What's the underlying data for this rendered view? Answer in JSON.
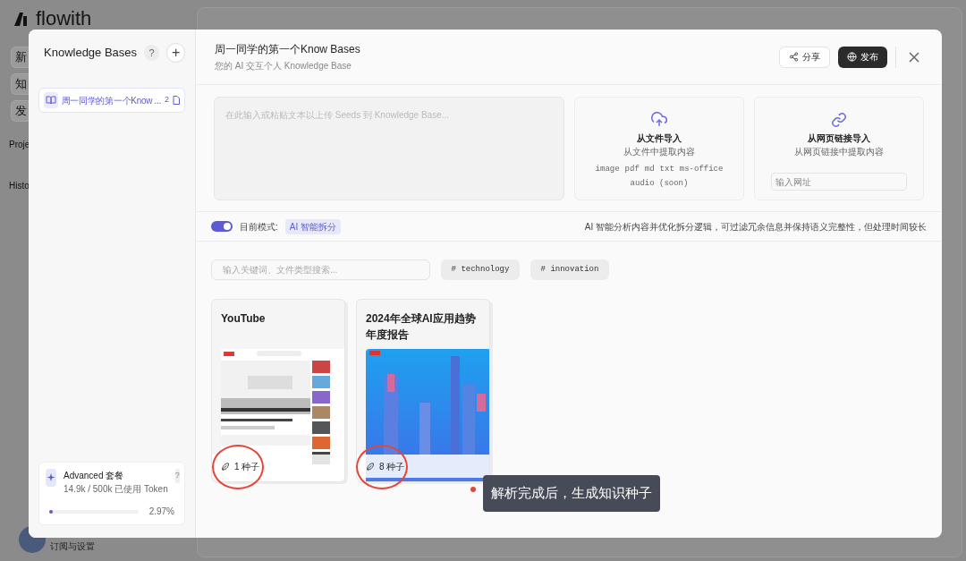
{
  "background_app": {
    "logo": "flowith",
    "nav_buttons": [
      "新",
      "知",
      "发"
    ],
    "section_labels": [
      "Proje",
      "Histo"
    ],
    "footer_link": "订阅与设置"
  },
  "sidebar": {
    "title": "Knowledge Bases",
    "help": "?",
    "add": "+",
    "items": [
      {
        "name": "周一同学的第一个Know ...",
        "count": "2",
        "selected": true
      }
    ],
    "plan": {
      "name": "Advanced 套餐",
      "usage": "14.9k / 500k 已使用 Token",
      "help": "?",
      "level": 0.0297,
      "percent": "2.97%"
    }
  },
  "header": {
    "title": "周一同学的第一个Know Bases",
    "subtitle": "您的 AI 交互个人 Knowledge Base",
    "share": "分享",
    "publish": "发布"
  },
  "upload": {
    "placeholder": "在此输入或粘贴文本以上传 Seeds 到 Knowledge Base...",
    "file_import": {
      "title": "从文件导入",
      "subtitle": "从文件中提取内容",
      "types": [
        "image",
        "pdf",
        "md",
        "txt",
        "ms-office",
        "audio (soon)"
      ]
    },
    "link_import": {
      "title": "从网页链接导入",
      "subtitle": "从网页链接中提取内容",
      "placeholder": "输入网址"
    }
  },
  "mode": {
    "on": true,
    "label": "目前模式:",
    "value": "AI 智能拆分",
    "description": "AI 智能分析内容并优化拆分逻辑，可过滤冗余信息并保持语义完整性，但处理时间较长"
  },
  "search": {
    "placeholder": "输入关键词、文件类型搜索..."
  },
  "tags": [
    "# technology",
    "# innovation"
  ],
  "seeds": [
    {
      "title": "YouTube",
      "kind": "video",
      "seeds": "1 种子"
    },
    {
      "title": "2024年全球AI应用趋势年度报告",
      "kind": "report",
      "seeds": "8 种子"
    }
  ],
  "annotation": {
    "text": "解析完成后，生成知识种子"
  }
}
